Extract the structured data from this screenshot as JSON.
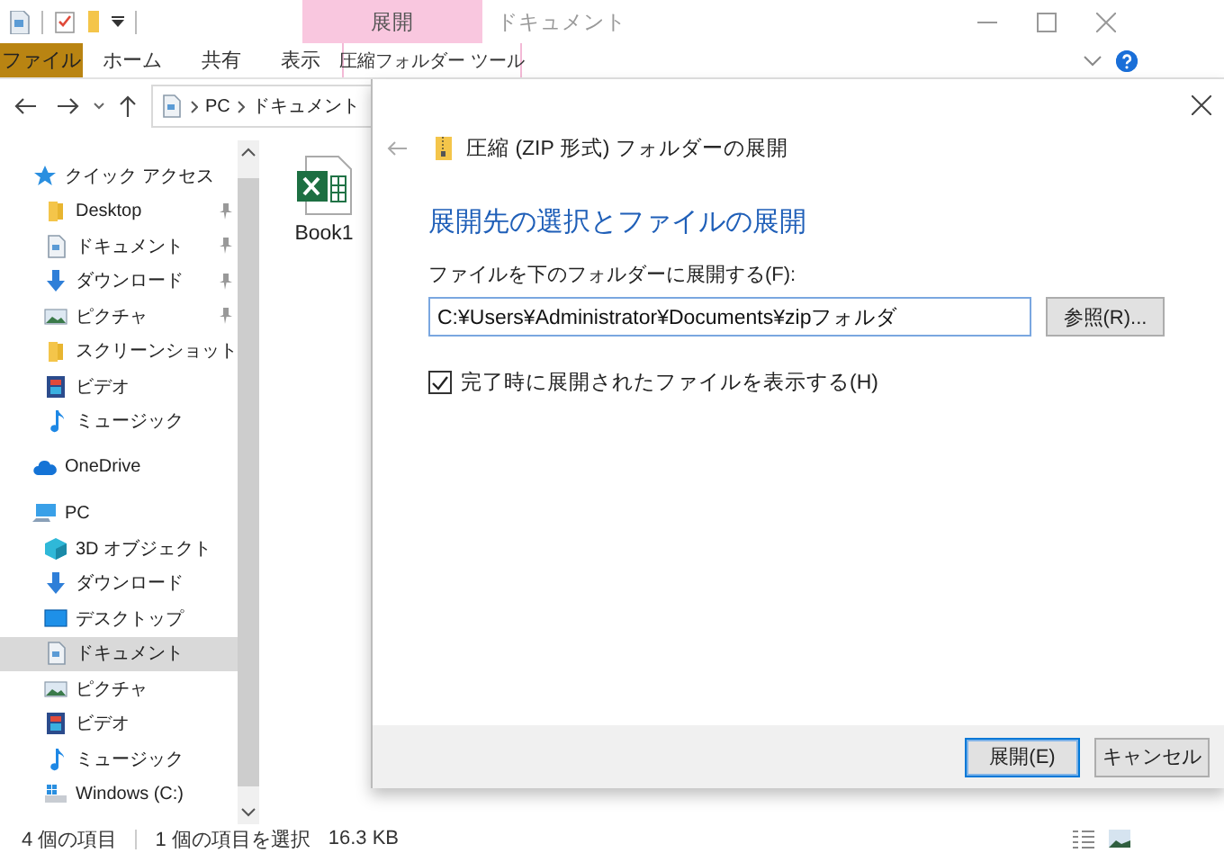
{
  "window": {
    "title": "ドキュメント",
    "context_group": "展開"
  },
  "ribbon_tabs": [
    {
      "label": "ファイル",
      "kind": "file"
    },
    {
      "label": "ホーム",
      "kind": "normal"
    },
    {
      "label": "共有",
      "kind": "normal"
    },
    {
      "label": "表示",
      "kind": "normal"
    },
    {
      "label": "圧縮フォルダー ツール",
      "kind": "context"
    }
  ],
  "address_bar": {
    "path": [
      "PC",
      "ドキュメント"
    ]
  },
  "navigation_pane": {
    "items": [
      {
        "label": "クイック アクセス",
        "kind": "star",
        "selected": false,
        "children": [
          {
            "label": "Desktop",
            "kind": "folder",
            "pinned": true,
            "selected": false
          },
          {
            "label": "ドキュメント",
            "kind": "document",
            "pinned": true,
            "selected": false
          },
          {
            "label": "ダウンロード",
            "kind": "download",
            "pinned": true,
            "selected": false
          },
          {
            "label": "ピクチャ",
            "kind": "pictures",
            "pinned": true,
            "selected": false
          },
          {
            "label": "スクリーンショット",
            "kind": "folder",
            "pinned": false,
            "selected": false
          },
          {
            "label": "ビデオ",
            "kind": "video",
            "pinned": false,
            "selected": false
          },
          {
            "label": "ミュージック",
            "kind": "music",
            "pinned": false,
            "selected": false
          }
        ]
      },
      {
        "label": "OneDrive",
        "kind": "cloud",
        "selected": false
      },
      {
        "label": "PC",
        "kind": "pc",
        "selected": false,
        "children": [
          {
            "label": "3D オブジェクト",
            "kind": "object3d",
            "selected": false
          },
          {
            "label": "ダウンロード",
            "kind": "download",
            "selected": false
          },
          {
            "label": "デスクトップ",
            "kind": "desktop",
            "selected": false
          },
          {
            "label": "ドキュメント",
            "kind": "document",
            "selected": true
          },
          {
            "label": "ピクチャ",
            "kind": "pictures",
            "selected": false
          },
          {
            "label": "ビデオ",
            "kind": "video",
            "selected": false
          },
          {
            "label": "ミュージック",
            "kind": "music",
            "selected": false
          },
          {
            "label": "Windows (C:)",
            "kind": "drive",
            "selected": false
          }
        ]
      }
    ]
  },
  "files": [
    {
      "name": "Book1",
      "kind": "excel"
    }
  ],
  "status_bar": {
    "item_count": "4 個の項目",
    "selection": "1 個の項目を選択",
    "size": "16.3 KB"
  },
  "dialog": {
    "title": "圧縮 (ZIP 形式) フォルダーの展開",
    "heading": "展開先の選択とファイルの展開",
    "destination_label": "ファイルを下のフォルダーに展開する(F):",
    "destination_value": "C:¥Users¥Administrator¥Documents¥zipフォルダ",
    "browse_button": "参照(R)...",
    "show_files": {
      "label": "完了時に展開されたファイルを表示する(H)",
      "checked": true
    },
    "buttons": [
      {
        "label": "展開(E)",
        "default": true
      },
      {
        "label": "キャンセル",
        "default": false
      }
    ]
  }
}
